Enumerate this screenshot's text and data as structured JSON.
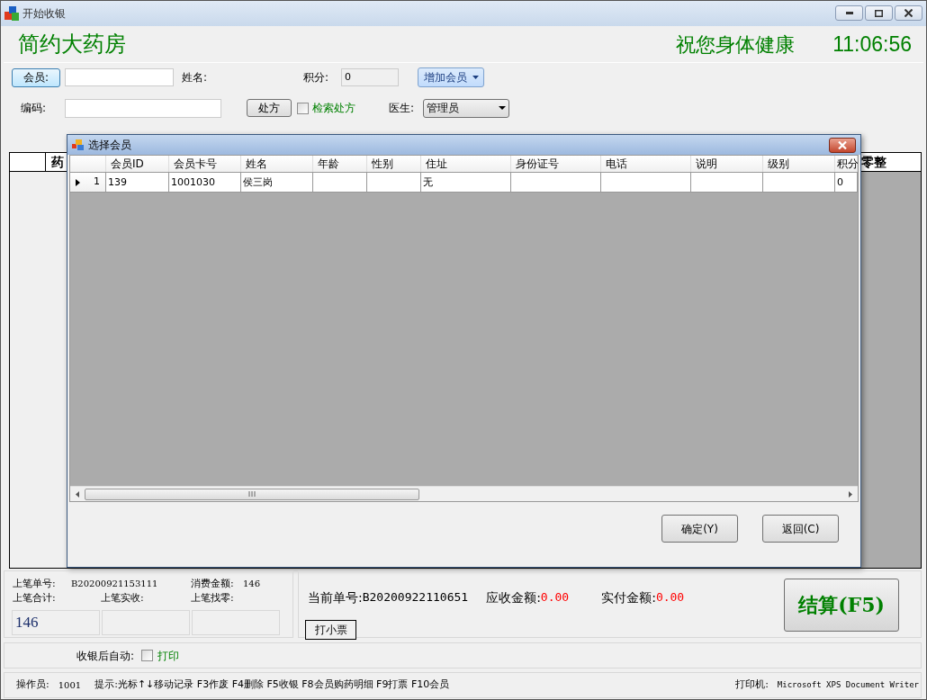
{
  "window": {
    "title": "开始收银"
  },
  "header": {
    "store_name": "简约大药房",
    "slogan": "祝您身体健康",
    "clock": "11:06:56"
  },
  "member_form": {
    "member_button": "会员:",
    "name_label": "姓名:",
    "points_label": "积分:",
    "points_value": "0",
    "add_member_button": "增加会员",
    "code_label": "编码:",
    "prescription_button": "处方",
    "search_prescription": {
      "label": "检索处方",
      "checked": false
    },
    "doctor_label": "医生:",
    "doctor_select": "管理员"
  },
  "main_grid": {
    "columns": [
      "药",
      "零整"
    ]
  },
  "dialog": {
    "title": "选择会员",
    "columns": [
      "会员ID",
      "会员卡号",
      "姓名",
      "年龄",
      "性别",
      "住址",
      "身份证号",
      "电话",
      "说明",
      "级别",
      "积分"
    ],
    "rows": [
      {
        "selected": true,
        "row_number": "1",
        "cells": [
          "139",
          "1001030",
          "侯三岗",
          "",
          "",
          "无",
          "",
          "",
          "",
          "",
          "0"
        ]
      }
    ],
    "buttons": [
      "确定(Y)",
      "返回(C)"
    ]
  },
  "last_bill": {
    "number_label": "上笔单号:",
    "number": "B20200921153111",
    "amount_label": "消费金额:",
    "amount": "146",
    "total_label": "上笔合计:",
    "received_label": "上笔实收:",
    "change_label": "上笔找零:",
    "total": "146"
  },
  "current_bill": {
    "number_label": "当前单号:",
    "number": "B20200922110651",
    "due_label": "应收金额:",
    "due": "0.00",
    "paid_label": "实付金额:",
    "paid": "0.00",
    "print_ticket_button": "打小票",
    "settle_button": "结算(F5)"
  },
  "auto_after_checkout": {
    "label": "收银后自动:",
    "print": {
      "label": "打印",
      "checked": false
    }
  },
  "status_bar": {
    "operator_label": "操作员:",
    "operator": "1001",
    "hint": "提示:光标↑↓移动记录 F3作废 F4删除 F5收银 F8会员购药明细 F9打票 F10会员",
    "printer_label": "打印机:",
    "printer": "Microsoft XPS Document Writer"
  }
}
